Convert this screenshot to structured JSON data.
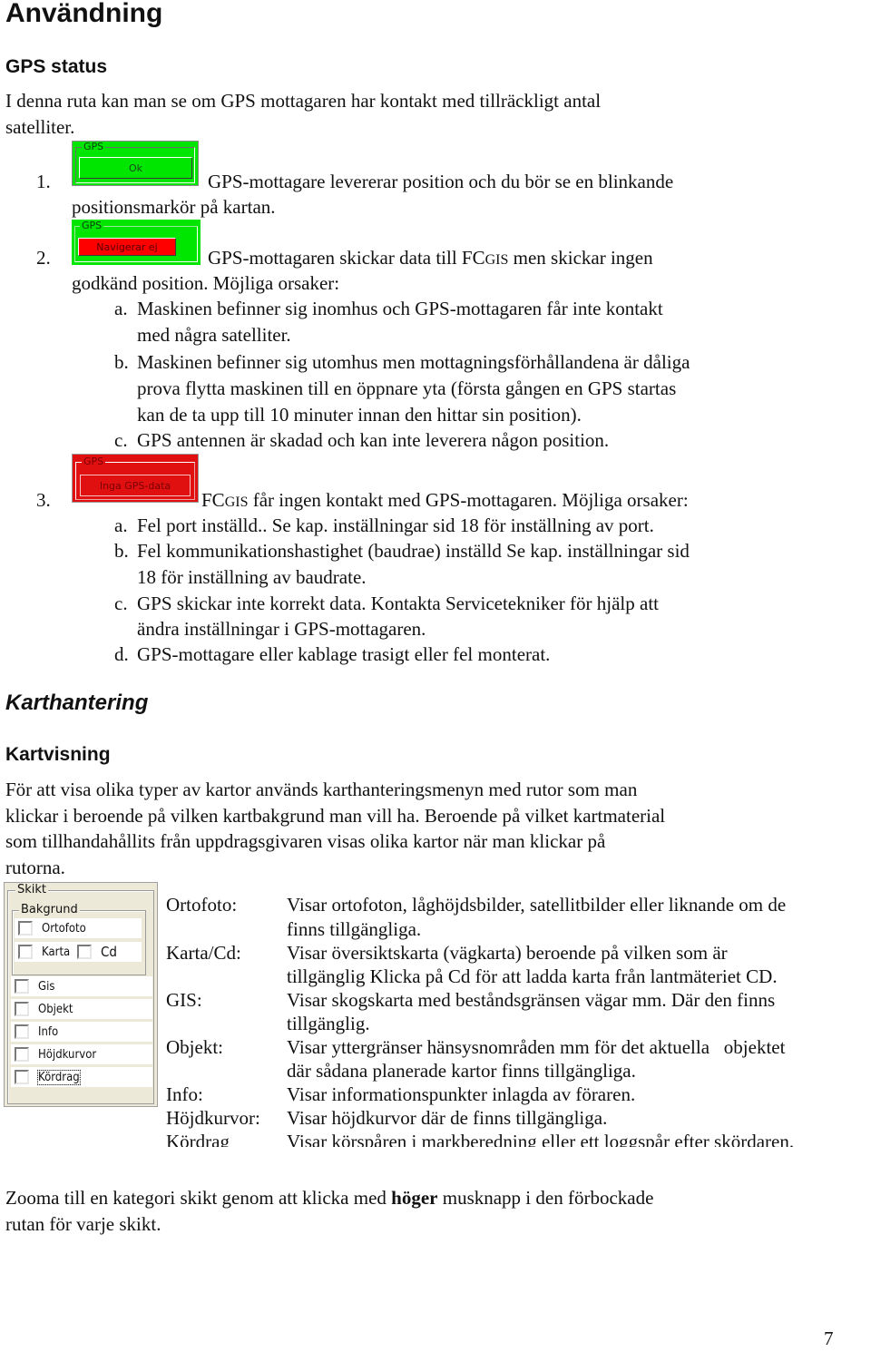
{
  "page_title": "Användning",
  "gps_section": {
    "heading": "GPS status",
    "intro_line1": "I denna ruta kan man se om GPS mottagaren har kontakt med tillräckligt antal",
    "intro_line2": "satelliter.",
    "items": [
      {
        "number": "1.",
        "widget": {
          "legend": "GPS",
          "button": "Ok",
          "frame_color": "#00e600",
          "button_color": "#00e600"
        },
        "line1": "GPS-mottagare levererar position och du bör se en blinkande",
        "line2": "positionsmarkör på kartan."
      },
      {
        "number": "2.",
        "widget": {
          "legend": "GPS",
          "button": "Navigerar ej",
          "frame_color": "#00e600",
          "button_color": "#ff0000"
        },
        "line1_pre": "GPS-mottagaren skickar data till FC",
        "line1_sc": "GIS",
        "line1_post": " men skickar ingen",
        "line2": "godkänd position. Möjliga orsaker:",
        "sub": [
          {
            "letter": "a.",
            "lines": [
              "Maskinen befinner sig inomhus och GPS-mottagaren får inte kontakt",
              "med några satelliter."
            ]
          },
          {
            "letter": "b.",
            "lines": [
              "Maskinen befinner sig utomhus men mottagningsförhållandena är dåliga",
              "prova flytta maskinen till en öppnare yta (första gången en GPS startas",
              "kan de ta upp till 10 minuter innan den hittar sin position)."
            ]
          },
          {
            "letter": "c.",
            "lines": [
              "GPS antennen är skadad och kan inte leverera någon position."
            ]
          }
        ]
      },
      {
        "number": "3.",
        "widget": {
          "legend": "GPS",
          "button": "Inga GPS-data",
          "frame_color": "#e01010",
          "button_color": "#e01010"
        },
        "line1_pre": "FC",
        "line1_sc": "GIS",
        "line1_post": " får ingen kontakt med GPS-mottagaren. Möjliga orsaker:",
        "sub": [
          {
            "letter": "a.",
            "lines": [
              "Fel port inställd.. Se kap. inställningar sid 18 för inställning av port."
            ]
          },
          {
            "letter": "b.",
            "lines": [
              "Fel kommunikationshastighet (baudrae) inställd Se kap. inställningar sid",
              "18 för inställning av baudrate."
            ]
          },
          {
            "letter": "c.",
            "lines": [
              "GPS skickar inte korrekt data. Kontakta Servicetekniker för hjälp att",
              "ändra inställningar i GPS-mottagaren."
            ]
          },
          {
            "letter": "d.",
            "lines": [
              "GPS-mottagare eller kablage trasigt eller fel monterat."
            ]
          }
        ]
      }
    ]
  },
  "karthantering": {
    "heading": "Karthantering",
    "subheading": "Kartvisning",
    "para_lines": [
      "För att visa olika typer av kartor används karthanteringsmenyn med rutor som man",
      "klickar i beroende på vilken kartbakgrund man vill ha. Beroende på vilket kartmaterial",
      "som tillhandahållits från uppdragsgivaren visas olika kartor när man klickar på",
      "rutorna."
    ],
    "skikt_panel": {
      "title": "Skikt",
      "group_title": "Bakgrund",
      "background_items": [
        {
          "label": "Ortofoto",
          "checked": false
        },
        {
          "label": "Karta",
          "checked": false
        },
        {
          "label": "Cd",
          "checked": false
        }
      ],
      "layer_items": [
        {
          "label": "Gis",
          "checked": false
        },
        {
          "label": "Objekt",
          "checked": false
        },
        {
          "label": "Info",
          "checked": false
        },
        {
          "label": "Höjdkurvor",
          "checked": false
        },
        {
          "label": "Kördrag",
          "checked": false,
          "focused": true
        }
      ]
    },
    "definitions": [
      {
        "term": "Ortofoto:",
        "lines": [
          "Visar ortofoton, låghöjdsbilder, satellitbilder eller liknande om de",
          "finns tillgängliga."
        ]
      },
      {
        "term": "Karta/Cd:",
        "lines": [
          "Visar översiktskarta (vägkarta) beroende på vilken som är",
          "tillgänglig Klicka på Cd för att ladda karta från lantmäteriet CD."
        ]
      },
      {
        "term": "GIS:",
        "lines": [
          "Visar skogskarta med beståndsgränsen vägar mm. Där den finns",
          "tillgänglig."
        ]
      },
      {
        "term": "Objekt:",
        "lines": [
          "Visar yttergränser hänsysnområden mm för det aktuella   objektet",
          "där sådana planerade kartor finns tillgängliga."
        ]
      },
      {
        "term": "Info:",
        "lines": [
          "Visar informationspunkter inlagda av föraren."
        ]
      },
      {
        "term": "Höjdkurvor:",
        "lines": [
          "Visar höjdkurvor där de finns tillgängliga."
        ]
      },
      {
        "term": "Kördrag",
        "lines": [
          "Visar körspåren i markberedning eller ett loggspår efter skördaren."
        ]
      }
    ],
    "zoom_note_pre": "Zooma till en kategori skikt genom att klicka med ",
    "zoom_note_bold": "höger",
    "zoom_note_post": " musknapp i den förbockade",
    "zoom_note_line2": "rutan för varje skikt."
  },
  "page_number": "7"
}
